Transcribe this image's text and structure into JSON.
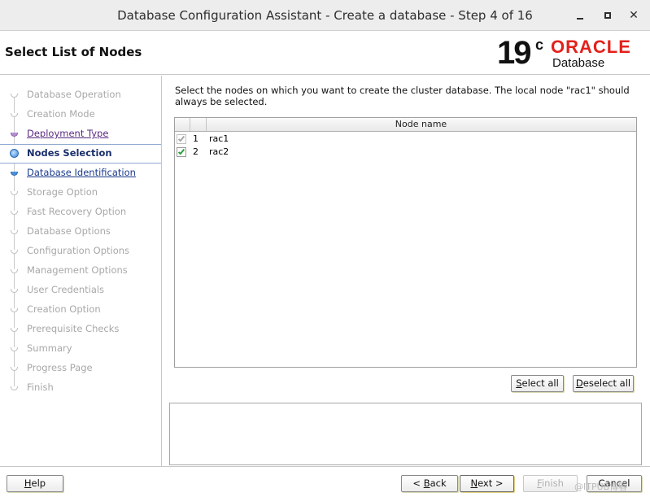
{
  "window": {
    "title": "Database Configuration Assistant - Create a database - Step 4 of 16",
    "close_glyph": "✕"
  },
  "header": {
    "page_title": "Select List of Nodes",
    "logo": {
      "version": "19",
      "superscript": "c",
      "brand": "ORACLE",
      "product": "Database",
      "brand_color": "#e3211b"
    }
  },
  "sidebar": {
    "steps": [
      {
        "label": "Database Operation",
        "state": "done"
      },
      {
        "label": "Creation Mode",
        "state": "done"
      },
      {
        "label": "Deployment Type",
        "state": "visited"
      },
      {
        "label": "Nodes Selection",
        "state": "current"
      },
      {
        "label": "Database Identification",
        "state": "link"
      },
      {
        "label": "Storage Option",
        "state": "pending"
      },
      {
        "label": "Fast Recovery Option",
        "state": "pending"
      },
      {
        "label": "Database Options",
        "state": "pending"
      },
      {
        "label": "Configuration Options",
        "state": "pending"
      },
      {
        "label": "Management Options",
        "state": "pending"
      },
      {
        "label": "User Credentials",
        "state": "pending"
      },
      {
        "label": "Creation Option",
        "state": "pending"
      },
      {
        "label": "Prerequisite Checks",
        "state": "pending"
      },
      {
        "label": "Summary",
        "state": "pending"
      },
      {
        "label": "Progress Page",
        "state": "pending"
      },
      {
        "label": "Finish",
        "state": "pending"
      }
    ]
  },
  "main": {
    "instruction": "Select the nodes on which you want to create the cluster database. The local node \"rac1\" should always be selected.",
    "table": {
      "column_header": "Node name",
      "rows": [
        {
          "num": "1",
          "name": "rac1",
          "checked": true,
          "disabled": true
        },
        {
          "num": "2",
          "name": "rac2",
          "checked": true,
          "disabled": false
        }
      ]
    },
    "select_all": {
      "mnemonic": "S",
      "rest": "elect all"
    },
    "deselect_all": {
      "mnemonic": "D",
      "rest": "eselect all"
    }
  },
  "footer": {
    "help": {
      "mnemonic": "H",
      "rest": "elp"
    },
    "back": {
      "pre": "< ",
      "mnemonic": "B",
      "rest": "ack"
    },
    "next": {
      "mnemonic": "N",
      "rest": "ext >"
    },
    "finish": {
      "mnemonic": "F",
      "rest": "inish"
    },
    "cancel": {
      "label": "Cancel"
    },
    "watermark": "@ITPUB博客"
  },
  "colors": {
    "accent": "#1a2f6b",
    "check_green": "#2e9e3a",
    "visited": "#5a2a82"
  }
}
